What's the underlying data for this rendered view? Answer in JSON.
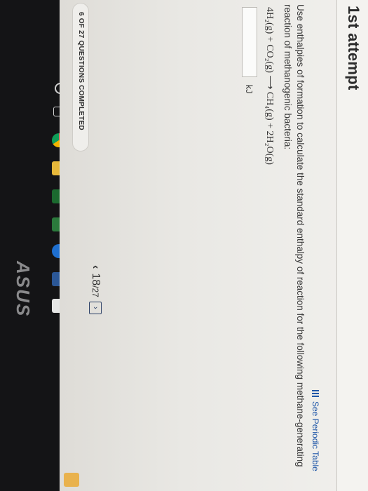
{
  "header": {
    "attempt_label": "1st attempt"
  },
  "toolbar": {
    "periodic_table_link": "See Periodic Table"
  },
  "question": {
    "prompt": "Use enthalpies of formation to calculate the standard enthalpy of reaction for the following methane-generating reaction of methanogenic bacteria:",
    "equation": "4H₂(g) + CO₂(g) ⟶ CH₄(g) + 2H₂O(g)",
    "answer_value": "",
    "answer_unit": "kJ"
  },
  "progress": {
    "status_text": "6 OF 27 QUESTIONS COMPLETED"
  },
  "pager": {
    "current": "18",
    "total": "/27",
    "prev_symbol": "‹",
    "next_symbol": "›"
  },
  "taskbar": {
    "icons": [
      "search-icon",
      "task-view-icon",
      "chrome-icon",
      "file-explorer-icon",
      "store-icon",
      "sway-icon",
      "edge-icon",
      "word-icon",
      "mail-icon"
    ]
  },
  "brand": {
    "logo": "ASUS"
  },
  "colors": {
    "link": "#1f57a8",
    "screen_bg": "#f1f0ed",
    "taskbar_bg": "#141416",
    "accent_badge": "#e9b24d"
  }
}
